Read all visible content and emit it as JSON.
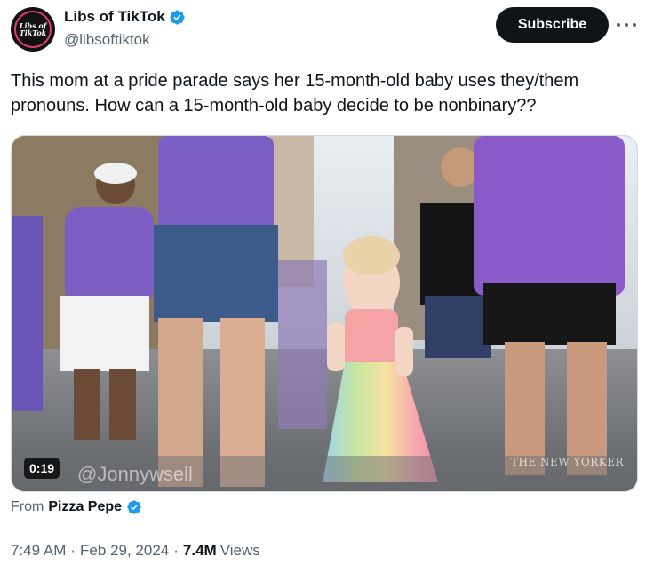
{
  "author": {
    "display_name": "Libs of TikTok",
    "handle": "@libsoftiktok",
    "avatar_text_line1": "Libs of",
    "avatar_text_line2": "TikTok",
    "verified_color": "#1d9bf0"
  },
  "header": {
    "subscribe_label": "Subscribe",
    "more_icon": "more-horizontal-icon"
  },
  "tweet": {
    "text": "This mom at a pride parade says her 15-month-old baby uses they/them pronouns. How can a 15-month-old baby decide to be nonbinary??"
  },
  "media": {
    "duration": "0:19",
    "watermark_left": "@Jonnywsell",
    "watermark_right": "THE NEW YORKER"
  },
  "source": {
    "from_label": "From",
    "from_name": "Pizza Pepe"
  },
  "meta": {
    "time": "7:49 AM",
    "date": "Feb 29, 2024",
    "views_count": "7.4M",
    "views_label": "Views"
  },
  "colors": {
    "text_primary": "#0f1419",
    "text_secondary": "#536471",
    "subscribe_bg": "#0f1419"
  }
}
